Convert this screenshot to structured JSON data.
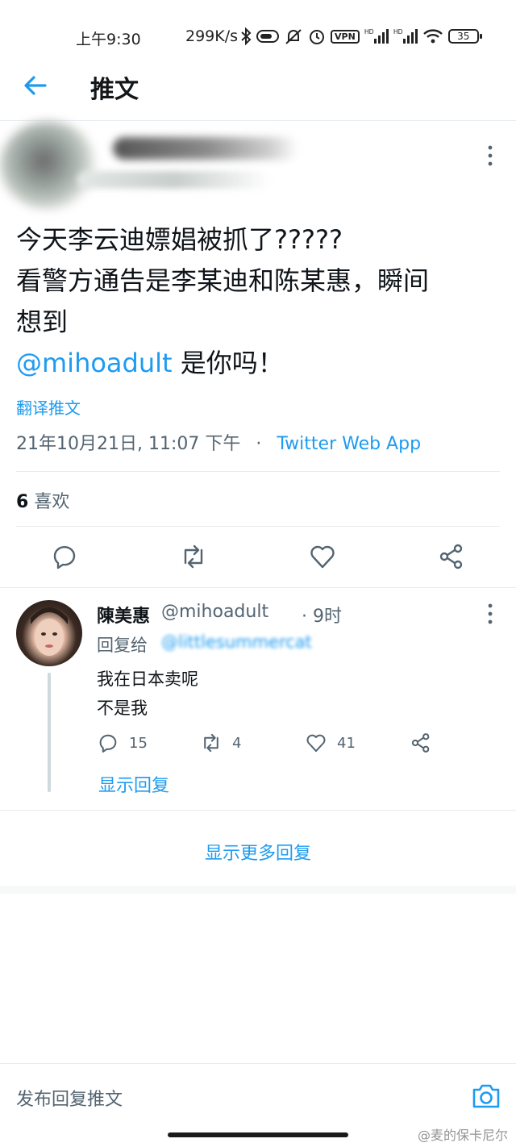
{
  "status_bar": {
    "time": "上午9:30",
    "net_speed": "299K/s",
    "vpn": "VPN",
    "battery": "35"
  },
  "header": {
    "title": "推文"
  },
  "tweet": {
    "lines": [
      "今天李云迪嫖娼被抓了?????",
      "看警方通告是李某迪和陈某惠，瞬间",
      "想到"
    ],
    "mention": "@mihoadult",
    "mention_suffix": " 是你吗！",
    "translate": "翻译推文",
    "timestamp": "21年10月21日, 11:07 下午",
    "dot": "·",
    "source": "Twitter Web App",
    "likes_count": "6",
    "likes_label": "喜欢"
  },
  "reply": {
    "name": "陳美惠",
    "handle": "@mihoadult",
    "time": "· 9时",
    "reply_to_label": "回复给",
    "reply_to_handle": "@littlesummercat",
    "text_1": "我在日本卖呢",
    "text_2": "不是我",
    "reply_count": "15",
    "retweet_count": "4",
    "like_count": "41",
    "show_replies": "显示回复"
  },
  "more_replies": "显示更多回复",
  "compose": {
    "placeholder": "发布回复推文"
  },
  "watermark": "@麦的保卡尼尔",
  "colors": {
    "accent": "#1d9bf0",
    "secondary_text": "#536471",
    "divider": "#e6ecf0"
  }
}
